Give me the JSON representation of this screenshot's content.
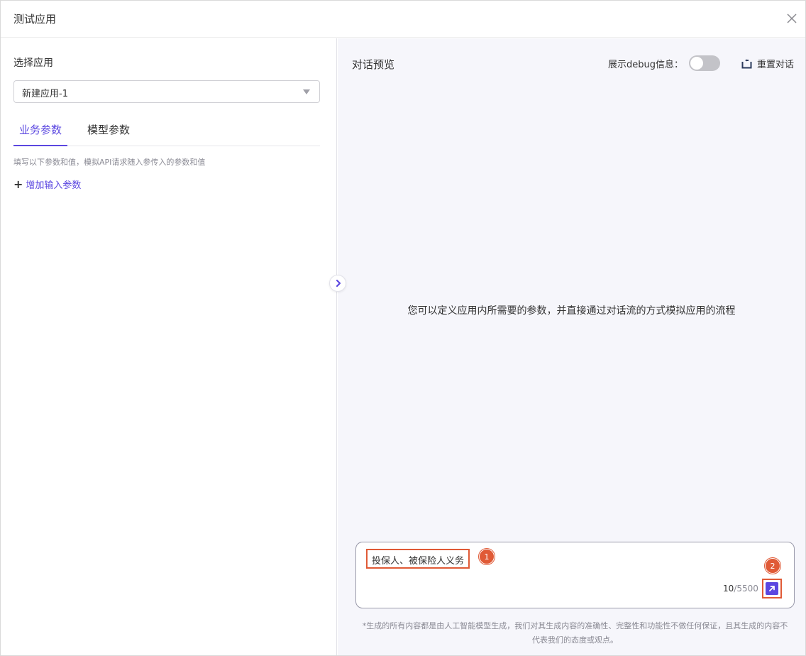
{
  "dialog": {
    "title": "测试应用"
  },
  "left_panel": {
    "select_label": "选择应用",
    "selected_app": "新建应用-1",
    "tabs": [
      {
        "label": "业务参数",
        "active": true
      },
      {
        "label": "模型参数",
        "active": false
      }
    ],
    "hint": "填写以下参数和值，模拟API请求随入参传入的参数和值",
    "add_param_label": "增加输入参数"
  },
  "right_panel": {
    "title": "对话预览",
    "debug_label": "展示debug信息：",
    "debug_enabled": false,
    "reset_label": "重置对话",
    "empty_message": "您可以定义应用内所需要的参数，并直接通过对话流的方式模拟应用的流程",
    "input": {
      "value": "投保人、被保险人义务",
      "count": "10",
      "max": "/5500"
    },
    "annotations": [
      "1",
      "2"
    ],
    "disclaimer": "*生成的所有内容都是由人工智能模型生成，我们对其生成内容的准确性、完整性和功能性不做任何保证，且其生成的内容不代表我们的态度或观点。"
  },
  "colors": {
    "accent": "#5b47e0",
    "highlight": "#e05a36",
    "panel_bg": "#f6f6fb"
  }
}
